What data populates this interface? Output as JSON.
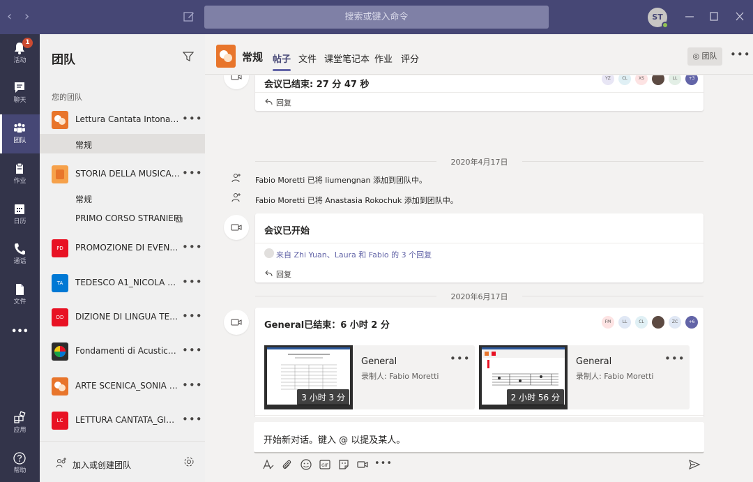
{
  "titlebar": {
    "search_placeholder": "搜索或键入命令",
    "avatar_initials": "ST",
    "nav_back": "‹",
    "nav_forward": "›"
  },
  "appbar": {
    "items": [
      {
        "label": "活动",
        "icon": "bell-icon",
        "badge": "1"
      },
      {
        "label": "聊天",
        "icon": "chat-icon"
      },
      {
        "label": "团队",
        "icon": "teams-icon"
      },
      {
        "label": "作业",
        "icon": "assignments-icon"
      },
      {
        "label": "日历",
        "icon": "calendar-icon"
      },
      {
        "label": "通话",
        "icon": "phone-icon"
      },
      {
        "label": "文件",
        "icon": "files-icon"
      }
    ],
    "more": "•••",
    "apps_label": "应用",
    "help_label": "帮助"
  },
  "teams_panel": {
    "title": "团队",
    "section_label": "您的团队",
    "teams": [
      {
        "name": "Lettura Cantata Intonazi...",
        "logo_text": "",
        "color": "#e8752b"
      },
      {
        "name": "STORIA DELLA MUSICA_...",
        "logo_text": "",
        "color": "#f6a14a"
      },
      {
        "name": "PROMOZIONE DI EVENTI...",
        "logo_text": "PD",
        "color": "#e81123"
      },
      {
        "name": "TEDESCO A1_NICOLA HA...",
        "logo_text": "TA",
        "color": "#0078d4"
      },
      {
        "name": "DIZIONE DI LINGUA TED...",
        "logo_text": "DD",
        "color": "#e81123"
      },
      {
        "name": "Fondamenti di Acustica ...",
        "logo_text": "",
        "color": "#2d2d2d"
      },
      {
        "name": "ARTE SCENICA_SONIA G...",
        "logo_text": "",
        "color": "#e8752b"
      },
      {
        "name": "LETTURA CANTATA_GIUS...",
        "logo_text": "LC",
        "color": "#e81123"
      }
    ],
    "channels": {
      "team0_general": "常规",
      "team1_general": "常规",
      "team1_private": "PRIMO CORSO STRANIERI"
    },
    "more": "•••",
    "join_label": "加入或创建团队"
  },
  "channel": {
    "title": "常规",
    "tabs": [
      "帖子",
      "文件",
      "课堂笔记本",
      "作业",
      "评分"
    ],
    "team_chip": "团队",
    "more": "•••"
  },
  "feed": {
    "card1": {
      "title": "会议已结束: 27 分 47 秒",
      "avatars": [
        "YZ",
        "CL",
        "XS",
        "",
        "LL",
        "+3"
      ]
    },
    "reply_label": "回复",
    "date1": "2020年4月17日",
    "sys1": {
      "actor": "Fabio Moretti",
      "verb": " 已将 ",
      "target": "liumengnan",
      "tail": " 添加到团队中。"
    },
    "sys2": {
      "actor": "Fabio Moretti",
      "verb": " 已将 ",
      "target": "Anastasia Rokochuk",
      "tail": " 添加到团队中。"
    },
    "card2": {
      "title": "会议已开始",
      "replies": "来自 Zhi Yuan、Laura 和 Fabio 的 3 个回复"
    },
    "date2": "2020年6月17日",
    "card3": {
      "title": "General已结束：6 小时 2 分",
      "avatars": [
        "FM",
        "LL",
        "CL",
        "",
        "ZC",
        "+6"
      ],
      "recordings": [
        {
          "title": "General",
          "by": "录制人: Fabio Moretti",
          "duration": "3 小时 3 分"
        },
        {
          "title": "General",
          "by": "录制人: Fabio Moretti",
          "duration": "2 小时 56 分"
        }
      ]
    }
  },
  "composer": {
    "placeholder": "开始新对话。键入 @ 以提及某人。"
  },
  "colors": {
    "titlebar": "#464775",
    "appbar": "#33344a",
    "accent": "#6264a7",
    "badge": "#cc4a31"
  }
}
